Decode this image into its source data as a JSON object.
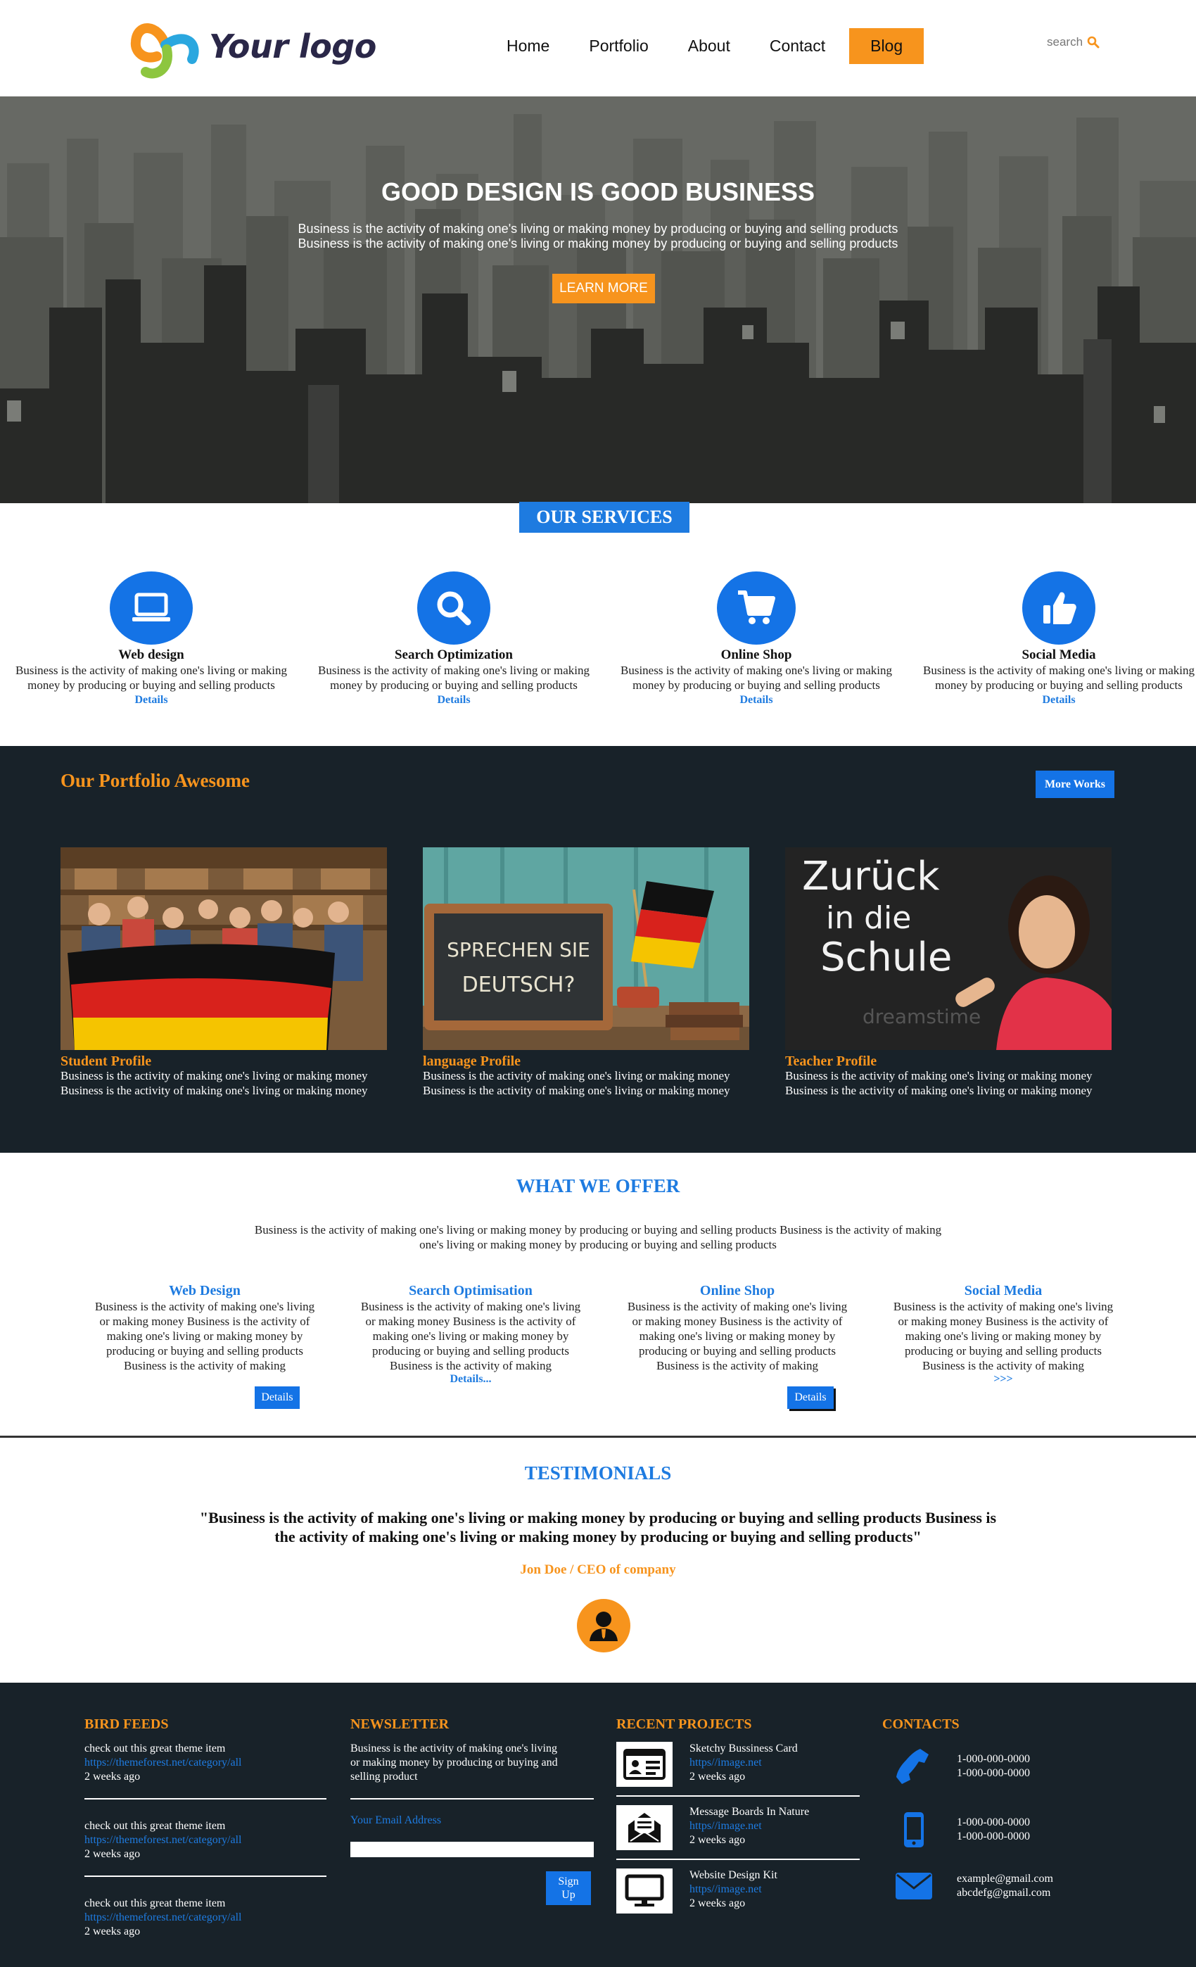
{
  "header": {
    "logo_text": "Your logo",
    "nav": [
      "Home",
      "Portfolio",
      "About",
      "Contact",
      "Blog"
    ],
    "active_nav": "Blog",
    "search_label": "search"
  },
  "hero": {
    "title": "GOOD DESIGN IS GOOD BUSINESS",
    "subtitle_line1": "Business is the activity of making one's living or making money by producing or buying and selling products",
    "subtitle_line2": "Business is the activity of making one's living or making money by producing or buying and selling products",
    "button": "LEARN MORE"
  },
  "services": {
    "title": "OUR SERVICES",
    "items": [
      {
        "icon": "laptop-icon",
        "title": "Web design",
        "text_line1": "Business is the activity of making one's living or making",
        "text_line2": "money by producing or buying and selling products",
        "link": "Details"
      },
      {
        "icon": "search-icon",
        "title": "Search Optimization",
        "text_line1": "Business is the activity of making one's living or making",
        "text_line2": "money by producing or buying and selling products",
        "link": "Details"
      },
      {
        "icon": "cart-icon",
        "title": "Online Shop",
        "text_line1": "Business is the activity of making one's living or making",
        "text_line2": "money by producing or buying and selling products",
        "link": "Details"
      },
      {
        "icon": "thumbs-up-icon",
        "title": "Social Media",
        "text_line1": "Business is the activity of making one's living or making",
        "text_line2": "money by producing or buying and selling products",
        "link": "Details"
      }
    ]
  },
  "portfolio": {
    "title": "Our Portfolio Awesome",
    "more_button": "More Works",
    "items": [
      {
        "name": "Student Profile",
        "line1": "Business is the activity of making one's living or making money",
        "line2": "Business is the activity of making one's living or making money"
      },
      {
        "name": "language Profile",
        "line1": "Business is the activity of making one's living or making money",
        "line2": "Business is the activity of making one's living or making money",
        "chalk_line1": "SPRECHEN SIE",
        "chalk_line2": "DEUTSCH?"
      },
      {
        "name": "Teacher Profile",
        "line1": "Business is the activity of making one's living or making money",
        "line2": "Business is the activity of making one's living or making money",
        "chalk_line1": "Zurück",
        "chalk_line2": "in die",
        "chalk_line3": "Schule",
        "watermark": "dreamstime"
      }
    ]
  },
  "offer": {
    "title": "WHAT WE OFFER",
    "intro_line1": "Business is the activity of making one's living or making money by producing or buying and selling products Business is the activity of making",
    "intro_line2": "one's living or making money by producing or buying and selling products",
    "items": [
      {
        "title": "Web Design",
        "lines": [
          "Business is the activity of making one's living",
          "or making money Business is the activity of",
          "making one's living or making money by",
          "producing or buying and selling products",
          "Business is the activity of making"
        ],
        "action": "Details"
      },
      {
        "title": "Search Optimisation",
        "lines": [
          "Business is the activity of making one's living",
          "or making money Business is the activity of",
          "making one's living or making money by",
          "producing or buying and selling products",
          "Business is the activity of making"
        ],
        "action": "Details..."
      },
      {
        "title": "Online Shop",
        "lines": [
          "Business is the activity of making one's living",
          "or making money Business is the activity of",
          "making one's living or making money by",
          "producing or buying and selling products",
          "Business is the activity of making"
        ],
        "action": "Details"
      },
      {
        "title": "Social Media",
        "lines": [
          "Business is the activity of making one's living",
          "or making money Business is the activity of",
          "making one's living or making money by",
          "producing or buying and selling products",
          "Business is the activity of making"
        ],
        "action": ">>>"
      }
    ]
  },
  "testimonials": {
    "title": "TESTIMONIALS",
    "quote_line1": "\"Business is the activity of making one's living or making money by producing or buying and selling products Business is",
    "quote_line2": "the activity of making one's living or making money by producing or buying and selling products\"",
    "author": "Jon Doe / CEO of company"
  },
  "footer": {
    "bird_feeds": {
      "title": "BIRD FEEDS",
      "items": [
        {
          "text": "check out this great theme item",
          "link": "https://themeforest.net/category/all",
          "time": "2 weeks ago"
        },
        {
          "text": "check out this great theme item",
          "link": "https://themeforest.net/category/all",
          "time": "2 weeks ago"
        },
        {
          "text": "check out this great theme item",
          "link": "https://themeforest.net/category/all",
          "time": "2 weeks ago"
        }
      ]
    },
    "newsletter": {
      "title": "NEWSLETTER",
      "text_line1": "Business is the activity of making one's living",
      "text_line2": "or making money by producing or buying and",
      "text_line3": "selling product",
      "email_label": "Your Email Address",
      "signup_line1": "Sign",
      "signup_line2": "Up"
    },
    "recent_projects": {
      "title": "RECENT PROJECTS",
      "items": [
        {
          "icon": "id-card-icon",
          "name": "Sketchy Bussiness Card",
          "link": "https//image.net",
          "time": "2 weeks ago"
        },
        {
          "icon": "envelope-open-icon",
          "name": "Message Boards In Nature",
          "link": "https//image.net",
          "time": "2 weeks ago"
        },
        {
          "icon": "monitor-icon",
          "name": "Website Design Kit",
          "link": "https//image.net",
          "time": "2 weeks ago"
        }
      ]
    },
    "contacts": {
      "title": "CONTACTS",
      "items": [
        {
          "icon": "phone-icon",
          "line1": "1-000-000-0000",
          "line2": "1-000-000-0000"
        },
        {
          "icon": "mobile-icon",
          "line1": "1-000-000-0000",
          "line2": "1-000-000-0000"
        },
        {
          "icon": "mail-icon",
          "line1": "example@gmail.com",
          "line2": "abcdefg@gmail.com"
        }
      ]
    }
  },
  "colors": {
    "accent": "#f7941d",
    "primary": "#1473e6",
    "dark": "#182229"
  }
}
